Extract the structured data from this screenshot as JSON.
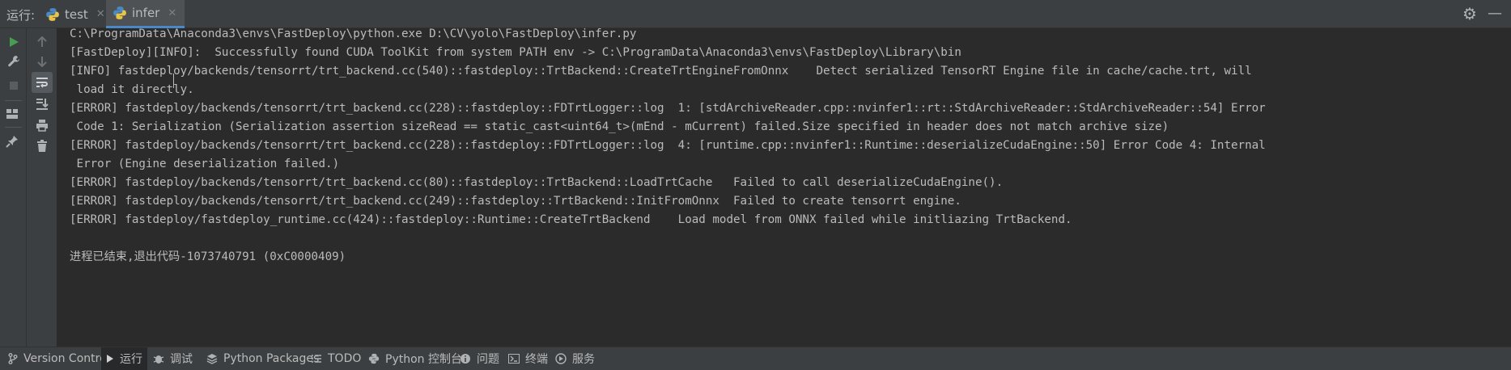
{
  "header": {
    "run_label": "运行:",
    "tabs": [
      {
        "label": "test",
        "icon": "python-icon",
        "active": false
      },
      {
        "label": "infer",
        "icon": "python-icon",
        "active": true
      }
    ],
    "settings_icon": "gear-icon",
    "minimize_icon": "minimize-icon"
  },
  "toolbar": {
    "primary": [
      "run-icon",
      "wrench-icon",
      "stop-icon",
      "layout-icon",
      "pin-icon"
    ],
    "secondary": [
      "arrow-up-icon",
      "arrow-down-icon",
      "soft-wrap-icon",
      "scroll-to-end-icon",
      "print-icon",
      "trash-icon"
    ]
  },
  "console": {
    "lines": [
      "C:\\ProgramData\\Anaconda3\\envs\\FastDeploy\\python.exe D:\\CV\\yolo\\FastDeploy\\infer.py",
      "[FastDeploy][INFO]:  Successfully found CUDA ToolKit from system PATH env -> C:\\ProgramData\\Anaconda3\\envs\\FastDeploy\\Library\\bin",
      "[INFO] fastdeploy/backends/tensorrt/trt_backend.cc(540)::fastdeploy::TrtBackend::CreateTrtEngineFromOnnx    Detect serialized TensorRT Engine file in cache/cache.trt, will",
      " load it directly.",
      "[ERROR] fastdeploy/backends/tensorrt/trt_backend.cc(228)::fastdeploy::FDTrtLogger::log  1: [stdArchiveReader.cpp::nvinfer1::rt::StdArchiveReader::StdArchiveReader::54] Error",
      " Code 1: Serialization (Serialization assertion sizeRead == static_cast<uint64_t>(mEnd - mCurrent) failed.Size specified in header does not match archive size)",
      "[ERROR] fastdeploy/backends/tensorrt/trt_backend.cc(228)::fastdeploy::FDTrtLogger::log  4: [runtime.cpp::nvinfer1::Runtime::deserializeCudaEngine::50] Error Code 4: Internal",
      " Error (Engine deserialization failed.)",
      "[ERROR] fastdeploy/backends/tensorrt/trt_backend.cc(80)::fastdeploy::TrtBackend::LoadTrtCache   Failed to call deserializeCudaEngine().",
      "[ERROR] fastdeploy/backends/tensorrt/trt_backend.cc(249)::fastdeploy::TrtBackend::InitFromOnnx  Failed to create tensorrt engine.",
      "[ERROR] fastdeploy/fastdeploy_runtime.cc(424)::fastdeploy::Runtime::CreateTrtBackend    Load model from ONNX failed while initliazing TrtBackend.",
      "",
      "进程已结束,退出代码-1073740791 (0xC0000409)"
    ]
  },
  "bottom_bar": {
    "items": [
      {
        "label": "Version Control",
        "icon": "vcs-branch-icon",
        "active": false
      },
      {
        "label": "运行",
        "icon": "run-play-icon",
        "active": true
      },
      {
        "label": "调试",
        "icon": "debug-bug-icon",
        "active": false
      },
      {
        "label": "Python Packages",
        "icon": "packages-layers-icon",
        "active": false
      },
      {
        "label": "TODO",
        "icon": "todo-list-icon",
        "active": false
      },
      {
        "label": "Python 控制台",
        "icon": "python-console-icon",
        "active": false
      },
      {
        "label": "问题",
        "icon": "problems-info-icon",
        "active": false
      },
      {
        "label": "终端",
        "icon": "terminal-icon",
        "active": false
      },
      {
        "label": "服务",
        "icon": "services-icon",
        "active": false
      }
    ]
  },
  "colors": {
    "background": "#2b2b2b",
    "panel": "#3c3f41",
    "text": "#bbbbbb",
    "run_green": "#499c54",
    "tab_underline": "#4a88c7"
  }
}
